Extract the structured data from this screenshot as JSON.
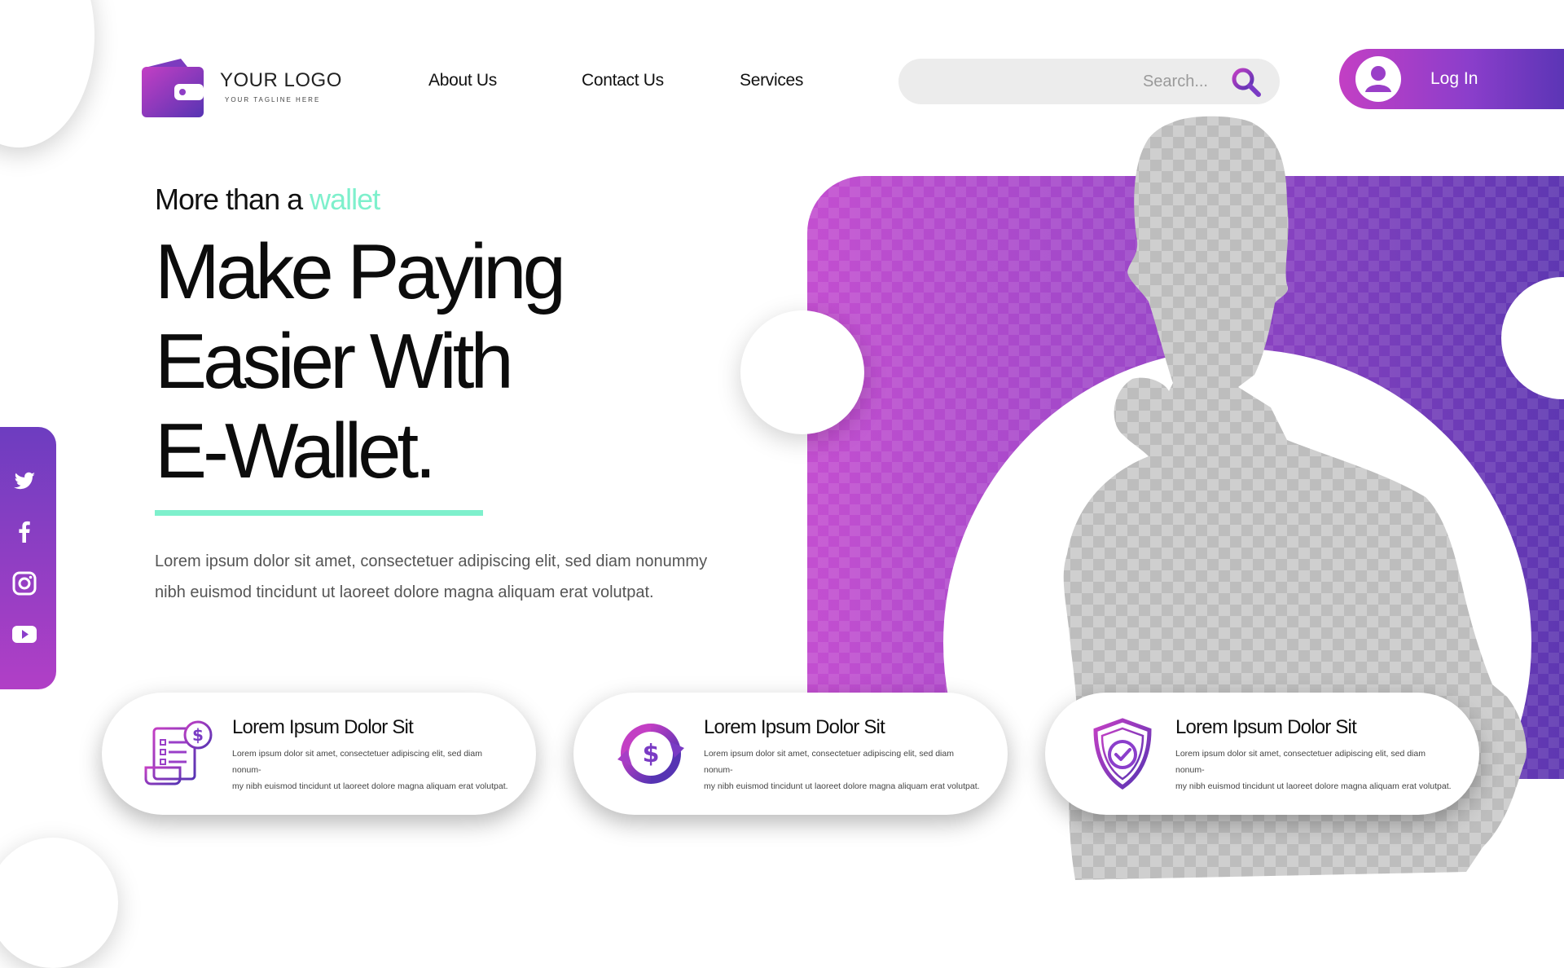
{
  "brand": {
    "logo_text": "YOUR LOGO",
    "tagline": "YOUR TAGLINE HERE"
  },
  "nav": {
    "items": [
      {
        "label": "About Us"
      },
      {
        "label": "Contact Us"
      },
      {
        "label": "Services"
      }
    ]
  },
  "search": {
    "placeholder": "Search..."
  },
  "login": {
    "label": "Log In"
  },
  "hero": {
    "subtitle_prefix": "More than a",
    "subtitle_accent": "wallet",
    "title_lines": [
      "Make Paying",
      "Easier With",
      "E-Wallet."
    ],
    "body_lines": [
      "Lorem ipsum dolor sit amet, consectetuer adipiscing elit, sed diam nonummy",
      "nibh euismod tincidunt ut laoreet dolore magna aliquam erat volutpat."
    ]
  },
  "social": [
    "twitter-icon",
    "facebook-icon",
    "instagram-icon",
    "youtube-icon"
  ],
  "features": [
    {
      "icon": "receipt-dollar-icon",
      "title": "Lorem Ipsum Dolor Sit",
      "body_lines": [
        "Lorem ipsum dolor sit amet, consectetuer adipiscing elit, sed diam nonum-",
        "my nibh euismod tincidunt ut laoreet dolore magna aliquam erat volutpat."
      ]
    },
    {
      "icon": "dollar-exchange-icon",
      "title": "Lorem Ipsum Dolor Sit",
      "body_lines": [
        "Lorem ipsum dolor sit amet, consectetuer adipiscing elit, sed diam nonum-",
        "my nibh euismod tincidunt ut laoreet dolore magna aliquam erat volutpat."
      ]
    },
    {
      "icon": "shield-check-icon",
      "title": "Lorem Ipsum Dolor Sit",
      "body_lines": [
        "Lorem ipsum dolor sit amet, consectetuer adipiscing elit, sed diam nonum-",
        "my nibh euismod tincidunt ut laoreet dolore magna aliquam erat volutpat."
      ]
    }
  ],
  "colors": {
    "accent_mint": "#7ef0cc",
    "gradient_pink": "#c33fc4",
    "gradient_violet": "#5634b3"
  }
}
